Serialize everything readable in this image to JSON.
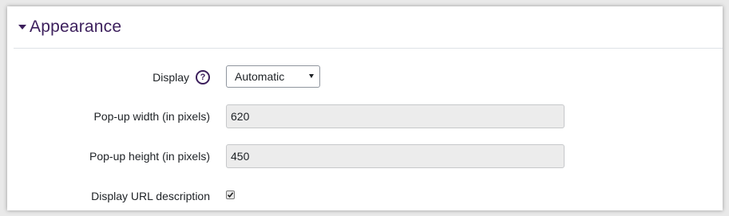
{
  "section": {
    "title": "Appearance",
    "expanded": true
  },
  "fields": {
    "display": {
      "label": "Display",
      "help_icon": "question-circle-icon",
      "selected": "Automatic"
    },
    "popup_width": {
      "label": "Pop-up width (in pixels)",
      "value": "620"
    },
    "popup_height": {
      "label": "Pop-up height (in pixels)",
      "value": "450"
    },
    "display_url_description": {
      "label": "Display URL description",
      "checked": true
    }
  },
  "colors": {
    "accent": "#3c1f5c",
    "input_bg": "#ececec"
  }
}
